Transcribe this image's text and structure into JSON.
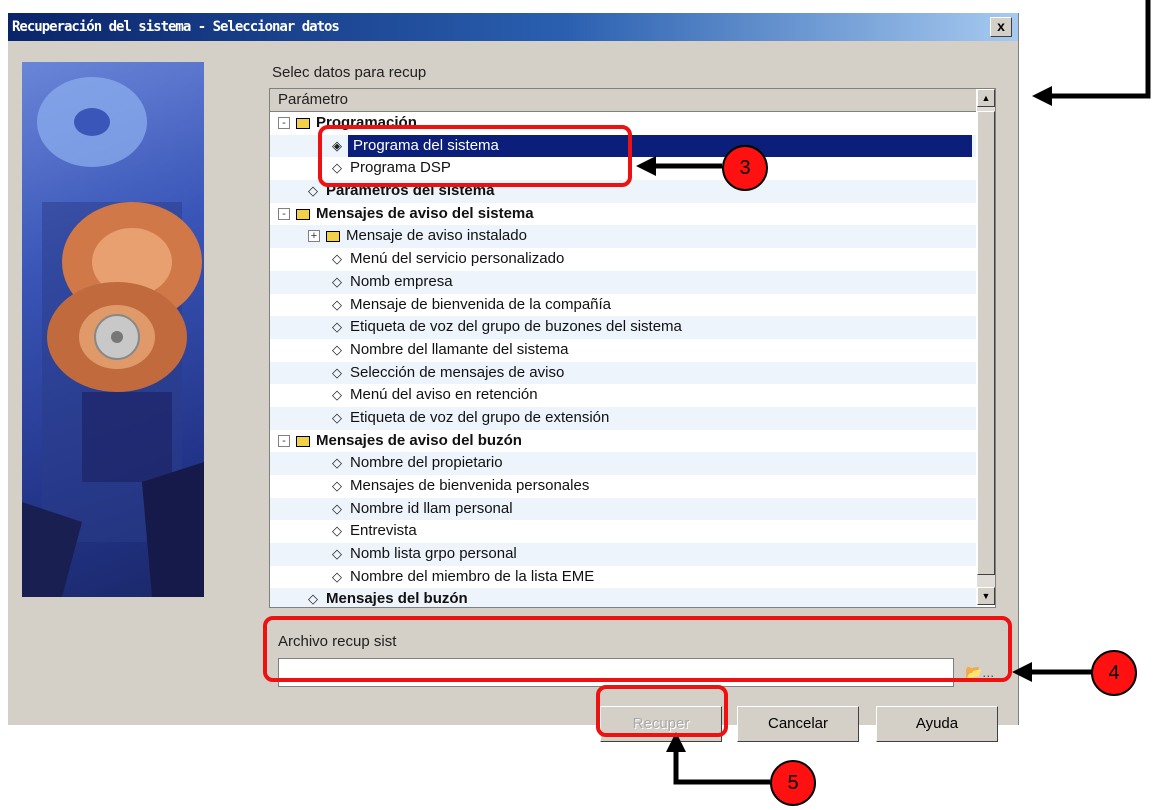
{
  "window": {
    "title": "Recuperación del sistema - Seleccionar datos",
    "close_label": "x"
  },
  "section_label": "Selec datos para recup",
  "tree": {
    "column_header": "Parámetro",
    "rows": [
      {
        "label": "Programación",
        "kind": "folder",
        "level": 0,
        "bold": true,
        "expander": "-"
      },
      {
        "label": "Programa del sistema",
        "kind": "radio",
        "level": 2,
        "selected": true
      },
      {
        "label": "Programa DSP",
        "kind": "radio",
        "level": 2
      },
      {
        "label": "Parámetros del sistema",
        "kind": "radio",
        "level": 1,
        "bold": true
      },
      {
        "label": "Mensajes de aviso del sistema",
        "kind": "folder",
        "level": 0,
        "bold": true,
        "expander": "-"
      },
      {
        "label": "Mensaje de aviso instalado",
        "kind": "folder",
        "level": 1,
        "expander": "+"
      },
      {
        "label": "Menú del servicio personalizado",
        "kind": "radio",
        "level": 2
      },
      {
        "label": "Nomb empresa",
        "kind": "radio",
        "level": 2
      },
      {
        "label": "Mensaje de bienvenida de la compañía",
        "kind": "radio",
        "level": 2
      },
      {
        "label": "Etiqueta de voz del grupo de buzones del sistema",
        "kind": "radio",
        "level": 2
      },
      {
        "label": "Nombre del llamante del sistema",
        "kind": "radio",
        "level": 2
      },
      {
        "label": "Selección de mensajes de aviso",
        "kind": "radio",
        "level": 2
      },
      {
        "label": "Menú del aviso en retención",
        "kind": "radio",
        "level": 2
      },
      {
        "label": "Etiqueta de voz del grupo de extensión",
        "kind": "radio",
        "level": 2
      },
      {
        "label": "Mensajes de aviso del buzón",
        "kind": "folder",
        "level": 0,
        "bold": true,
        "expander": "-"
      },
      {
        "label": "Nombre del propietario",
        "kind": "radio",
        "level": 2
      },
      {
        "label": "Mensajes de bienvenida personales",
        "kind": "radio",
        "level": 2
      },
      {
        "label": "Nombre id llam personal",
        "kind": "radio",
        "level": 2
      },
      {
        "label": "Entrevista",
        "kind": "radio",
        "level": 2
      },
      {
        "label": "Nomb lista grpo personal",
        "kind": "radio",
        "level": 2
      },
      {
        "label": "Nombre del miembro de la lista EME",
        "kind": "radio",
        "level": 2
      },
      {
        "label": "Mensajes del buzón",
        "kind": "radio",
        "level": 1,
        "bold": true
      }
    ]
  },
  "file": {
    "label": "Archivo recup sist",
    "value": "",
    "browse_label": "📂..."
  },
  "buttons": {
    "recover": "Recuper",
    "cancel": "Cancelar",
    "help": "Ayuda"
  },
  "annotations": {
    "three": "3",
    "four": "4",
    "five": "5"
  },
  "colors": {
    "annotation": "#ee1111",
    "selection": "#0a1e7a"
  }
}
